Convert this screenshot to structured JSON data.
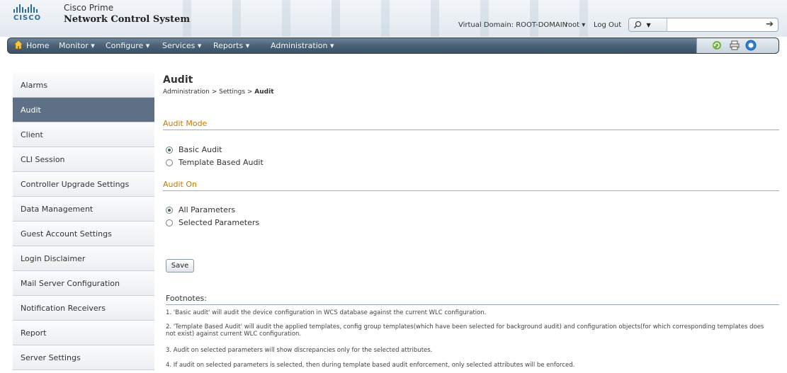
{
  "header": {
    "brand_line1": "Cisco Prime",
    "brand_line2": "Network Control System",
    "logo_word": "CISCO",
    "virtual_domain": "Virtual Domain: ROOT-DOMAIN",
    "user": "root ▾",
    "logout": "Log Out",
    "search_value": "",
    "search_scope_icon": "search-icon"
  },
  "nav": {
    "items": [
      {
        "label": "Home"
      },
      {
        "label": "Monitor ▾"
      },
      {
        "label": "Configure ▾"
      },
      {
        "label": "Services ▾"
      },
      {
        "label": "Reports ▾"
      },
      {
        "label": "Administration ▾"
      }
    ],
    "tools": [
      "refresh-icon",
      "print-icon",
      "help-icon"
    ]
  },
  "sidebar": {
    "items": [
      {
        "label": "Alarms"
      },
      {
        "label": "Audit"
      },
      {
        "label": "Client"
      },
      {
        "label": "CLI Session"
      },
      {
        "label": "Controller Upgrade Settings"
      },
      {
        "label": "Data Management"
      },
      {
        "label": "Guest Account Settings"
      },
      {
        "label": "Login Disclaimer"
      },
      {
        "label": "Mail Server Configuration"
      },
      {
        "label": "Notification Receivers"
      },
      {
        "label": "Report"
      },
      {
        "label": "Server Settings"
      }
    ],
    "active": "Audit"
  },
  "main": {
    "title": "Audit",
    "breadcrumb_prefix": "Administration > Settings > ",
    "breadcrumb_current": "Audit",
    "audit_mode": {
      "title": "Audit Mode",
      "options": [
        "Basic Audit",
        "Template Based Audit"
      ],
      "selected": "Basic Audit"
    },
    "audit_on": {
      "title": "Audit On",
      "options": [
        "All Parameters",
        "Selected Parameters"
      ],
      "selected": "All Parameters"
    },
    "save_label": "Save",
    "footnotes_title": "Footnotes:",
    "footnotes": [
      "1. 'Basic audit' will audit the device configuration in WCS database against the current WLC configuration.",
      "2. 'Template Based Audit' will audit the applied templates, config group templates(which have been selected for background audit) and configuration objects(for which corresponding templates does not exist) against current WLC configuration.",
      "3. Audit on selected parameters will show discrepancies only for the selected attributes.",
      "4. If audit on selected parameters is selected, then during template based audit enforcement, only selected attributes will be enforced."
    ]
  },
  "colors": {
    "nav_bg": "#4a6176",
    "sidebar_active": "#5d7085",
    "section_title": "#c07a00"
  }
}
